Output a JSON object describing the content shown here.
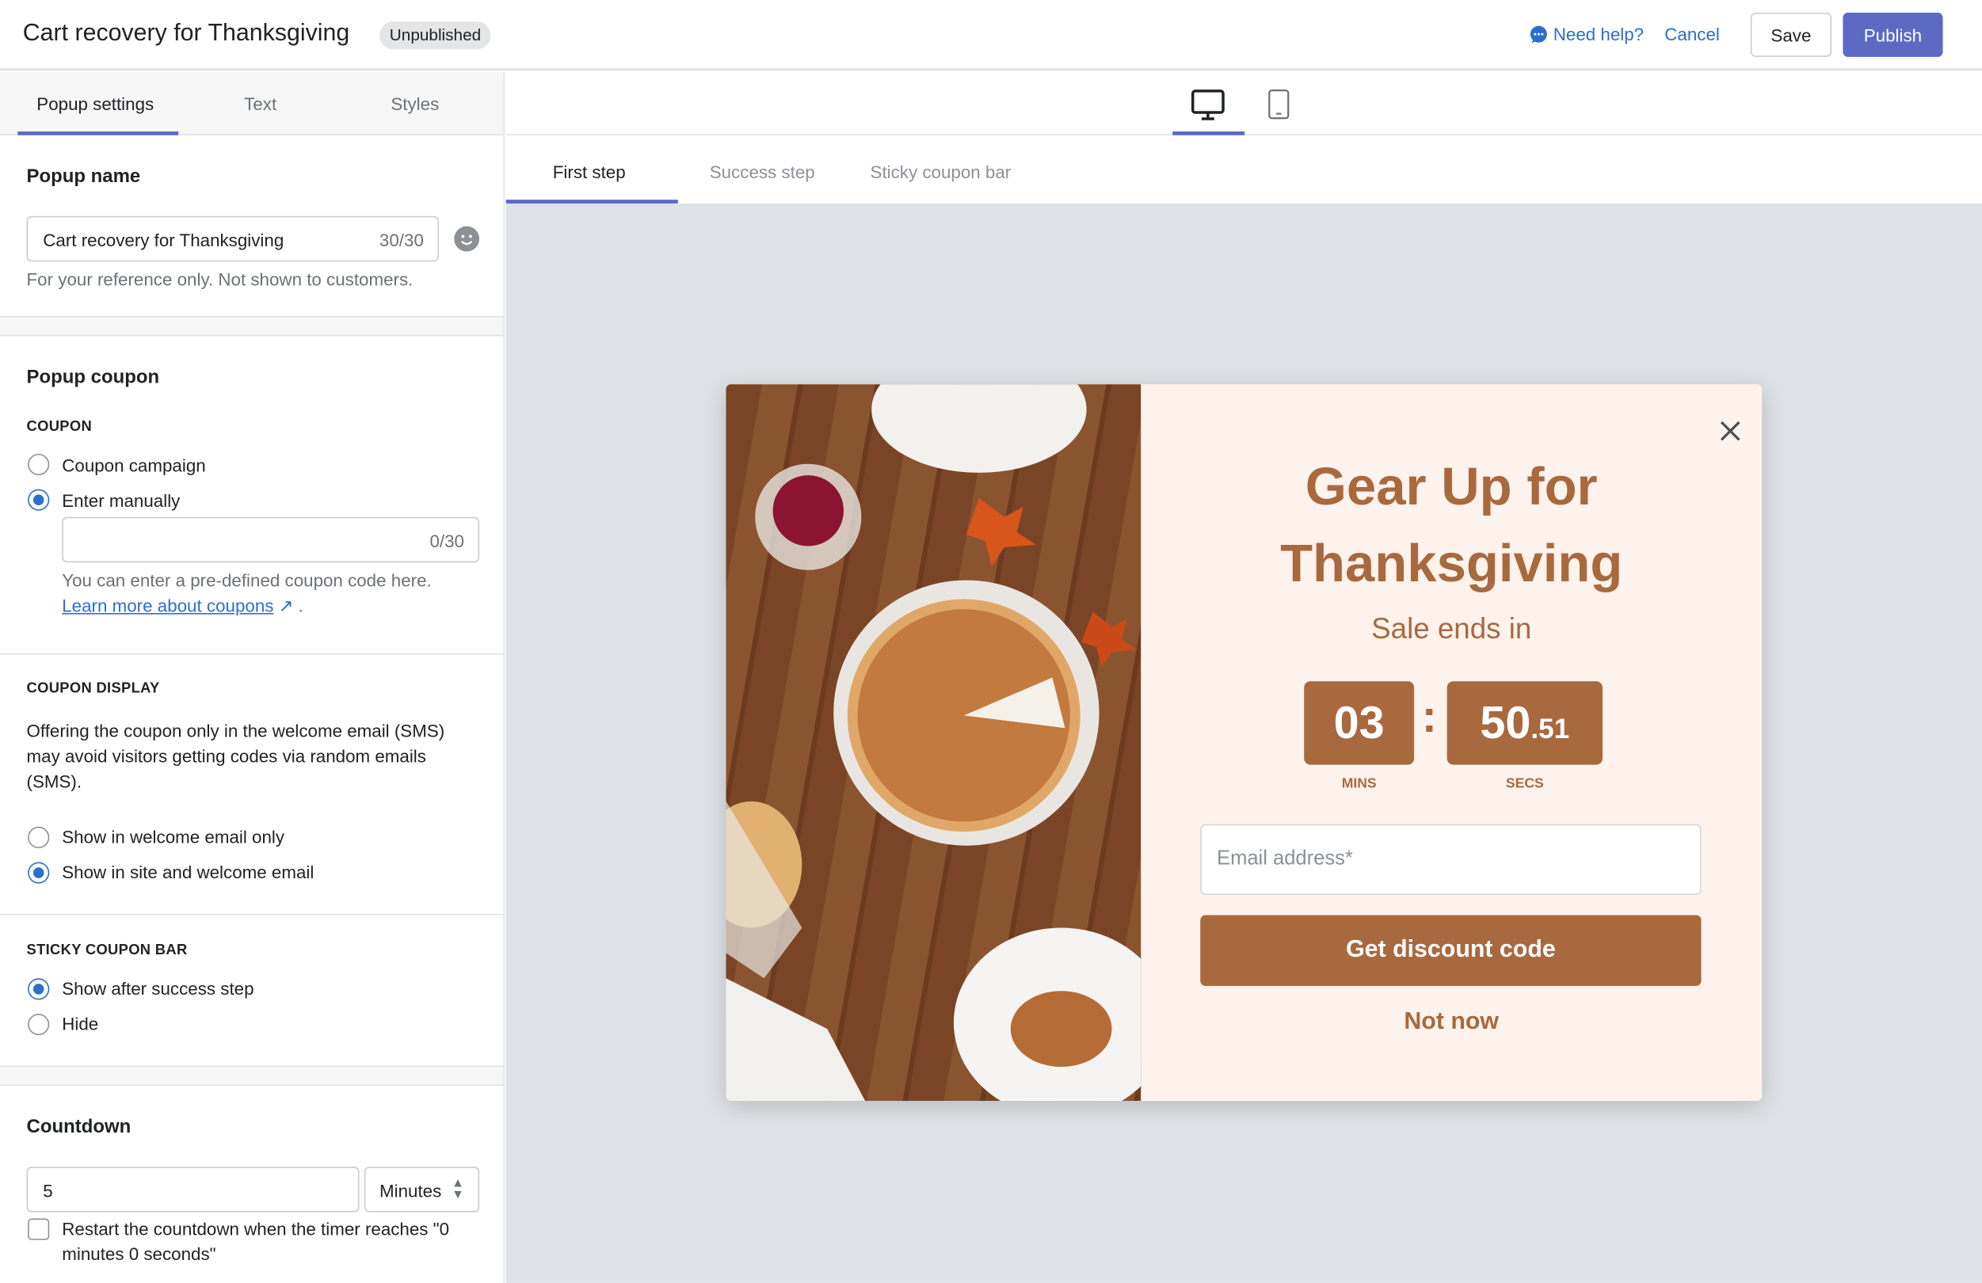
{
  "header": {
    "title": "Cart recovery for Thanksgiving",
    "status_badge": "Unpublished",
    "help": "Need help?",
    "cancel": "Cancel",
    "save": "Save",
    "publish": "Publish"
  },
  "left_tabs": [
    "Popup settings",
    "Text",
    "Styles"
  ],
  "popup_name": {
    "heading": "Popup name",
    "value": "Cart recovery for Thanksgiving",
    "count": "30/30",
    "help": "For your reference only. Not shown to customers."
  },
  "coupon": {
    "heading": "Popup coupon",
    "label": "COUPON",
    "options": [
      "Coupon campaign",
      "Enter manually"
    ],
    "selected": 1,
    "count": "0/30",
    "value": "",
    "help": "You can enter a pre-defined coupon code here.",
    "link": "Learn more about coupons",
    "link_suffix": "."
  },
  "coupon_display": {
    "label": "COUPON DISPLAY",
    "description": "Offering the coupon only in the welcome email (SMS) may avoid visitors getting codes via random emails (SMS).",
    "options": [
      "Show in welcome email only",
      "Show in site and welcome email"
    ],
    "selected": 1
  },
  "sticky_bar": {
    "label": "STICKY COUPON BAR",
    "options": [
      "Show after success step",
      "Hide"
    ],
    "selected": 0
  },
  "countdown": {
    "heading": "Countdown",
    "value": "5",
    "unit": "Minutes",
    "restart_label": "Restart the countdown when the timer reaches \"0 minutes 0 seconds\"",
    "restart_checked": false
  },
  "device_toggle": {
    "selected": "desktop",
    "options": [
      "desktop",
      "mobile"
    ]
  },
  "step_tabs": [
    "First step",
    "Success step",
    "Sticky coupon bar"
  ],
  "popup": {
    "title": "Gear Up for Thanksgiving",
    "subtitle": "Sale ends in",
    "mins": "03",
    "secs": "50",
    "secs_fraction": ".51",
    "mins_label": "MINS",
    "secs_label": "SECS",
    "colon": ":",
    "email_placeholder": "Email address*",
    "cta": "Get discount code",
    "dismiss": "Not now"
  },
  "colors": {
    "accent": "#5c6ac4",
    "link": "#2c6ecb",
    "popup_brand": "#a8693f",
    "popup_bg": "#fdf2ec",
    "canvas": "#dfe2e6"
  }
}
